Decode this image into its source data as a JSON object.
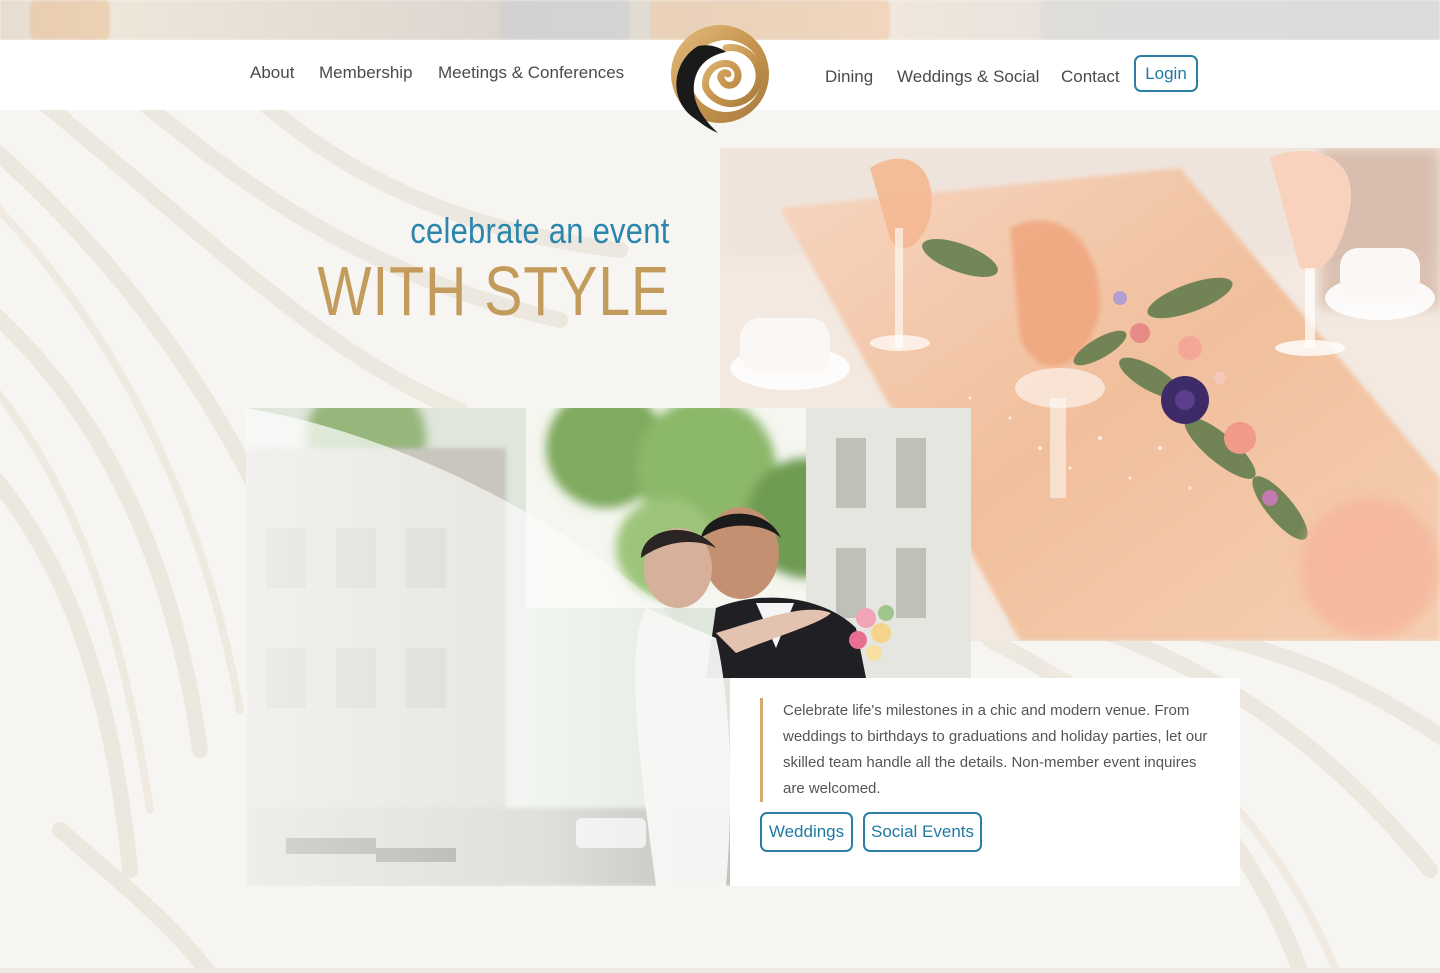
{
  "nav": {
    "left_items": [
      {
        "label": "About"
      },
      {
        "label": "Membership"
      },
      {
        "label": "Meetings & Conferences"
      }
    ],
    "right_items": [
      {
        "label": "Dining"
      },
      {
        "label": "Weddings & Social"
      },
      {
        "label": "Contact"
      }
    ],
    "login_label": "Login"
  },
  "hero": {
    "subtitle": "celebrate an event",
    "title": "WITH STYLE"
  },
  "card": {
    "description": "Celebrate life's milestones in a chic and modern venue. From weddings to birthdays to graduations and holiday parties, let our skilled team handle all the details. Non-member event inquires are welcomed.",
    "buttons": [
      {
        "label": "Weddings"
      },
      {
        "label": "Social Events"
      }
    ]
  },
  "colors": {
    "accent_blue": "#2b7ea4",
    "accent_gold": "#c39b5c",
    "background": "#f7f5f1"
  },
  "icons": {
    "logo": "swirl-logo-icon"
  }
}
